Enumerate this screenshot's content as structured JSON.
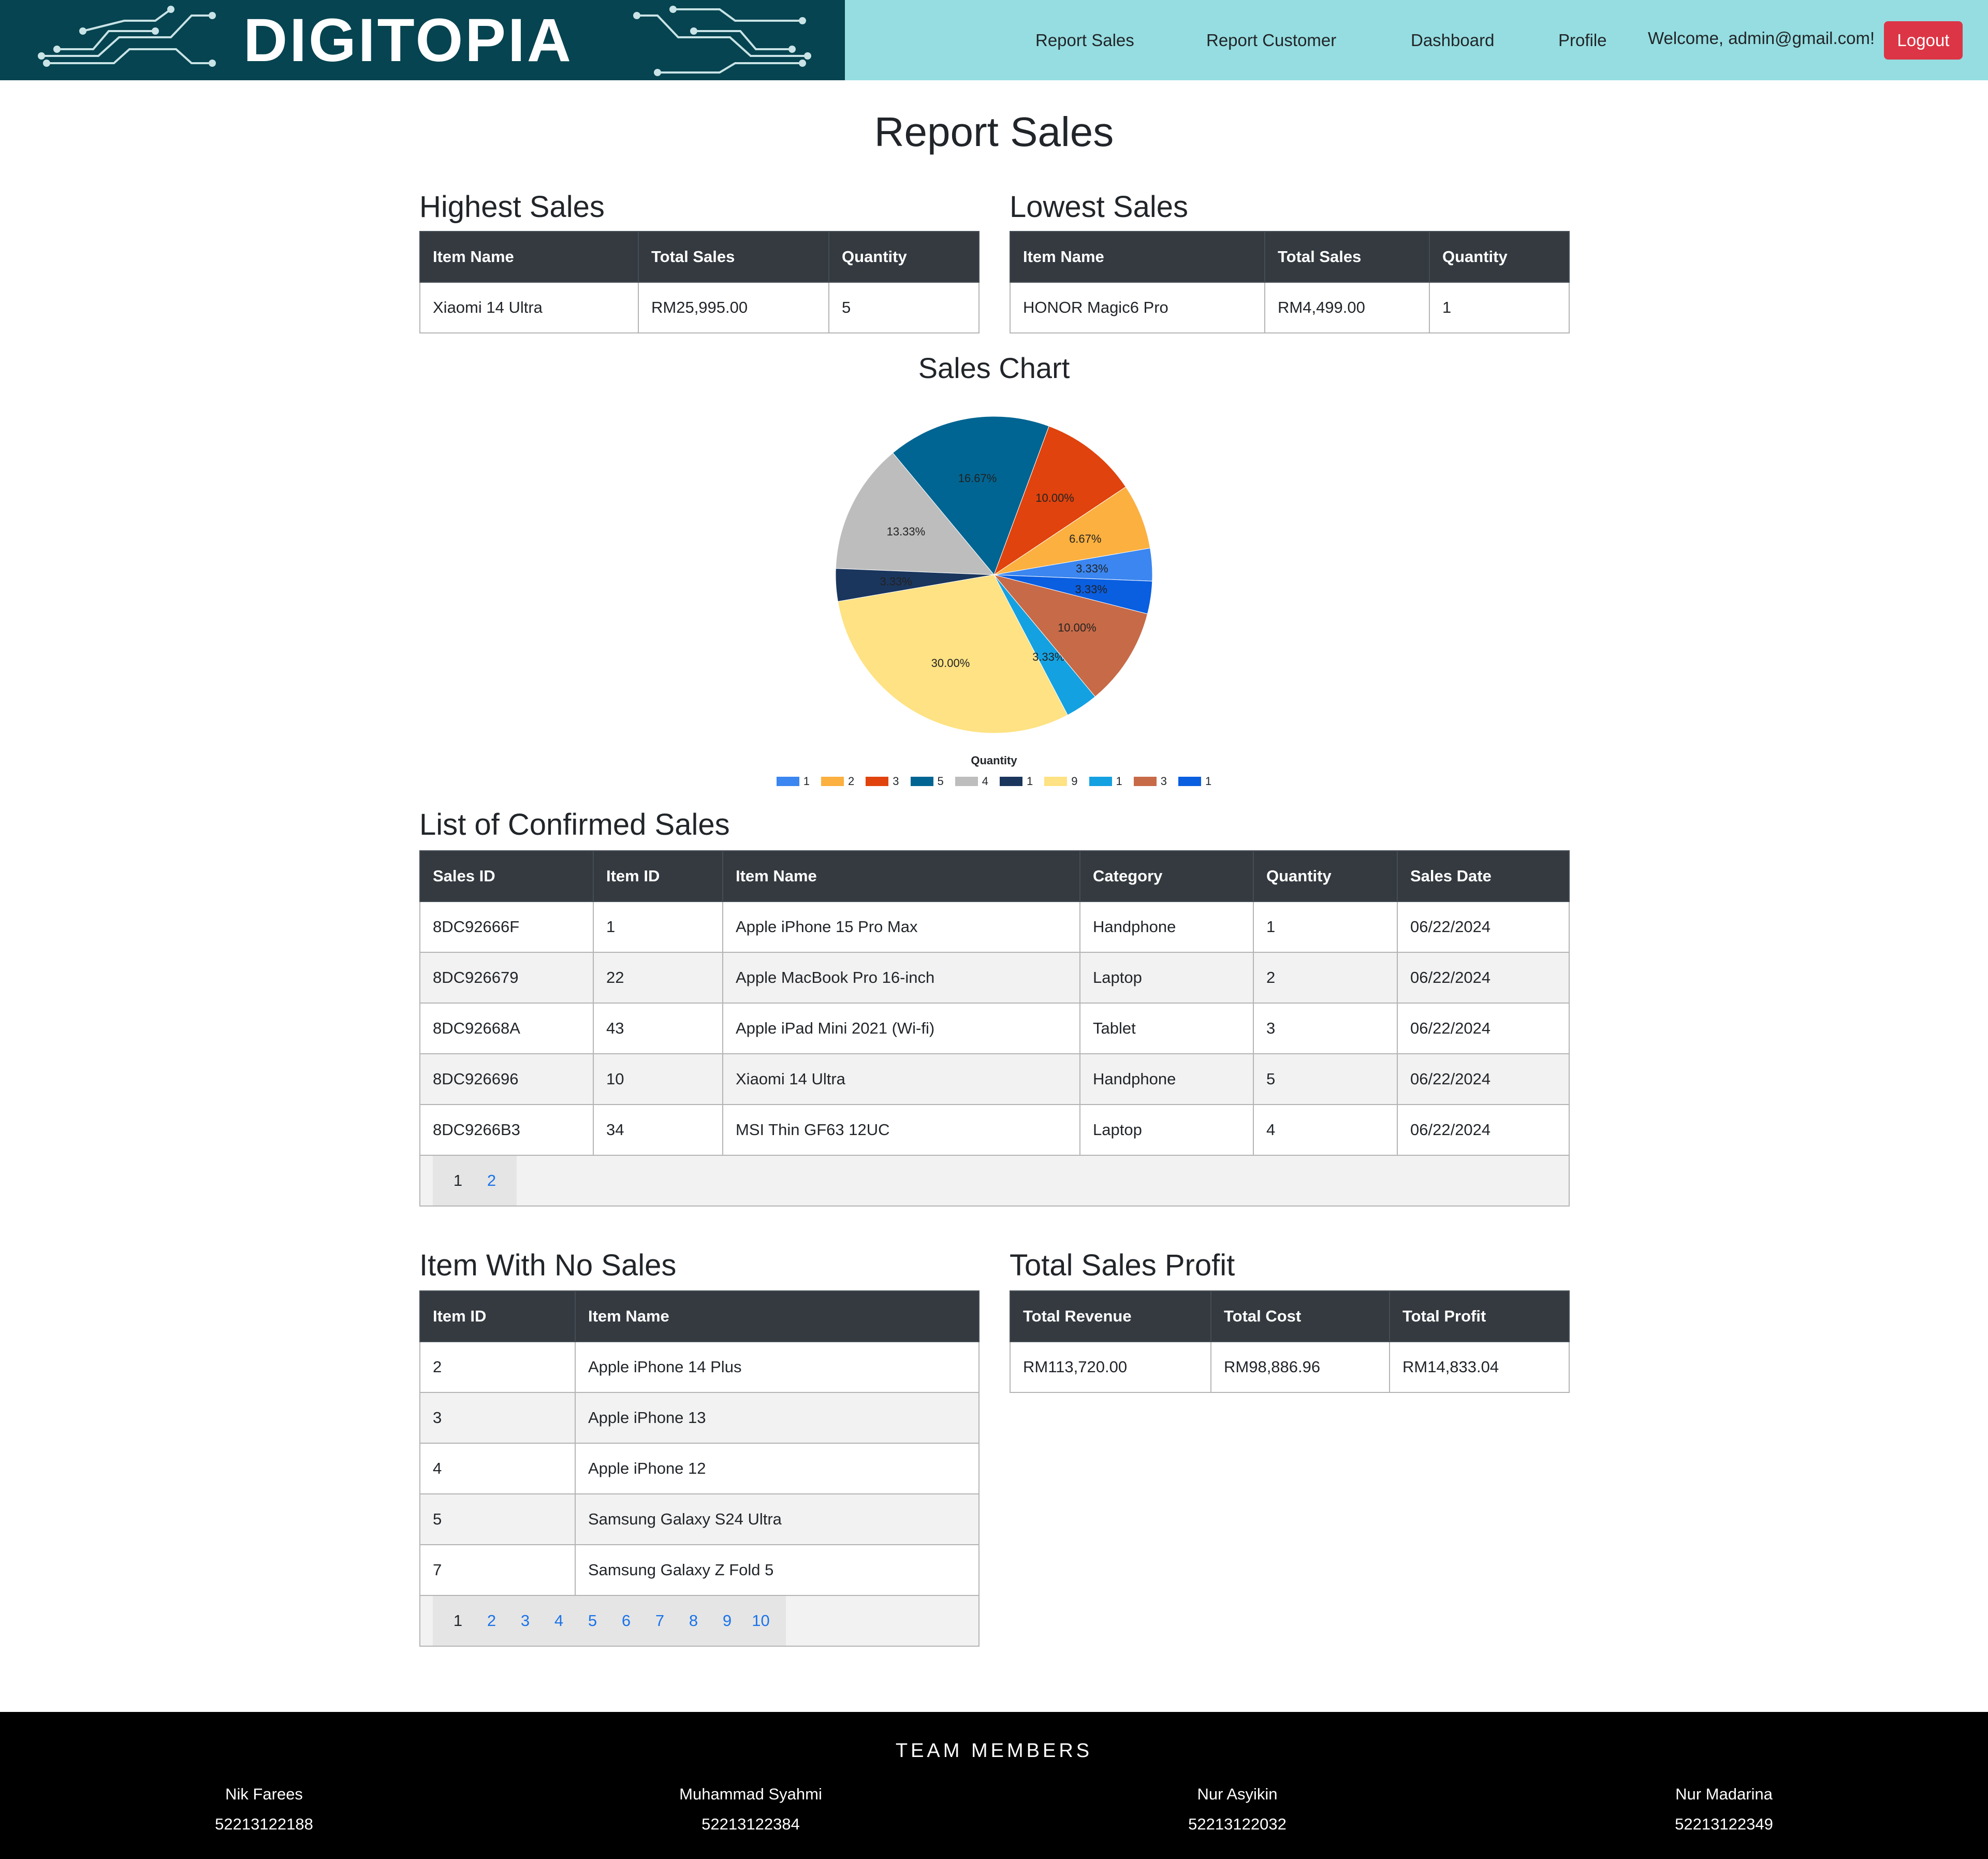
{
  "header": {
    "logo_text": "DIGITOPIA",
    "nav": [
      "Report Sales",
      "Report Customer",
      "Dashboard",
      "Profile"
    ],
    "welcome": "Welcome, admin@gmail.com!",
    "logout": "Logout"
  },
  "page_title": "Report Sales",
  "highest": {
    "title": "Highest Sales",
    "headers": [
      "Item Name",
      "Total Sales",
      "Quantity"
    ],
    "row": [
      "Xiaomi 14 Ultra",
      "RM25,995.00",
      "5"
    ]
  },
  "lowest": {
    "title": "Lowest Sales",
    "headers": [
      "Item Name",
      "Total Sales",
      "Quantity"
    ],
    "row": [
      "HONOR Magic6 Pro",
      "RM4,499.00",
      "1"
    ]
  },
  "chart_title": "Sales Chart",
  "chart_data": {
    "type": "pie",
    "legend_title": "Quantity",
    "categories": [
      "1",
      "2",
      "3",
      "5",
      "4",
      "1",
      "9",
      "1",
      "3",
      "1"
    ],
    "values": [
      1,
      2,
      3,
      5,
      4,
      1,
      9,
      1,
      3,
      1
    ],
    "percent_labels": [
      "3.33%",
      "6.67%",
      "10.00%",
      "16.67%",
      "13.33%",
      "3.33%",
      "30.00%",
      "3.33%",
      "10.00%",
      "3.33%"
    ],
    "colors": [
      "#3b86f0",
      "#fbb040",
      "#e0430d",
      "#006592",
      "#bdbdbd",
      "#1b365d",
      "#fee283",
      "#14a1e1",
      "#c76a47",
      "#0a5ee0"
    ],
    "legend_placement": "bottom"
  },
  "confirmed": {
    "title": "List of Confirmed Sales",
    "headers": [
      "Sales ID",
      "Item ID",
      "Item Name",
      "Category",
      "Quantity",
      "Sales Date"
    ],
    "rows": [
      [
        "8DC92666F",
        "1",
        "Apple iPhone 15 Pro Max",
        "Handphone",
        "1",
        "06/22/2024"
      ],
      [
        "8DC926679",
        "22",
        "Apple MacBook Pro 16-inch",
        "Laptop",
        "2",
        "06/22/2024"
      ],
      [
        "8DC92668A",
        "43",
        "Apple iPad Mini 2021 (Wi-fi)",
        "Tablet",
        "3",
        "06/22/2024"
      ],
      [
        "8DC926696",
        "10",
        "Xiaomi 14 Ultra",
        "Handphone",
        "5",
        "06/22/2024"
      ],
      [
        "8DC9266B3",
        "34",
        "MSI Thin GF63 12UC",
        "Laptop",
        "4",
        "06/22/2024"
      ]
    ],
    "pages": [
      "1",
      "2"
    ]
  },
  "nosales": {
    "title": "Item With No Sales",
    "headers": [
      "Item ID",
      "Item Name"
    ],
    "rows": [
      [
        "2",
        "Apple iPhone 14 Plus"
      ],
      [
        "3",
        "Apple iPhone 13"
      ],
      [
        "4",
        "Apple iPhone 12"
      ],
      [
        "5",
        "Samsung Galaxy S24 Ultra"
      ],
      [
        "7",
        "Samsung Galaxy Z Fold 5"
      ]
    ],
    "pages": [
      "1",
      "2",
      "3",
      "4",
      "5",
      "6",
      "7",
      "8",
      "9",
      "10"
    ]
  },
  "profit": {
    "title": "Total Sales Profit",
    "headers": [
      "Total Revenue",
      "Total Cost",
      "Total Profit"
    ],
    "row": [
      "RM113,720.00",
      "RM98,886.96",
      "RM14,833.04"
    ]
  },
  "footer": {
    "title": "TEAM MEMBERS",
    "members": [
      {
        "name": "Nik Farees",
        "id": "52213122188"
      },
      {
        "name": "Muhammad Syahmi",
        "id": "52213122384"
      },
      {
        "name": "Nur Asyikin",
        "id": "52213122032"
      },
      {
        "name": "Nur Madarina",
        "id": "52213122349"
      }
    ]
  }
}
